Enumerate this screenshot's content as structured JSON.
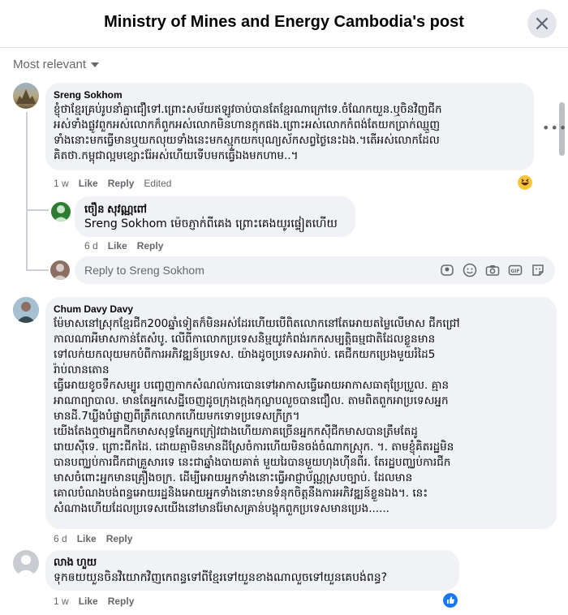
{
  "header": {
    "title": "Ministry of Mines and Energy Cambodia's post",
    "close_icon": "close-icon"
  },
  "sort": {
    "label": "Most relevant"
  },
  "comments": [
    {
      "author": "Sreng Sokhom",
      "text": "ខ្ញុំថាខ្មែរគ្រប់រូបនាំគ្នាជឿទៅ.ព្រោះសម័យឥឡូវចាប់បានតែខ្មែរណាក្រៅទេ.ចំណែកយួន.ឬចិនវិញជីក\nអស់ទាំងផ្លូវពួកអស់លោកក៏ពួកអស់លោកមិនហានក្តុកផង.ព្រោះអស់លោកកំពង់តែយកប្រាក់ឈ្មួញ\nទាំងនោះមកធ្វើមានឬយកលុយទាំងនេះមកស្មុកយកបុណ្យស័កសព្វថ្ងៃនេះឯង.។តើអស់លោកដែល\nគិតថា.កម្ពុជាល្អមខ្សោះរ៉ែអស់ហើយទើបមកធ្វើឯងមកហាម..។",
      "time": "1 w",
      "like": "Like",
      "reply": "Reply",
      "edited": "Edited",
      "reaction": "haha"
    },
    {
      "author": "ចឿន សុវណ្ណពៅ",
      "text": "Sreng Sokhom ម៉េចភ្ញាក់ពីគេង ព្រោះគេងយូរផ្ទៀតហើយ",
      "time": "6 d",
      "like": "Like",
      "reply": "Reply"
    },
    {
      "author": "Chum Davy Davy",
      "text": "ម៉ែមាសនៅស្រុកខ្មែរជីក200ឆ្នាំទៀតក៏មិនអស់ដែរហើយបើពិតលោកនៅតែអោយតម្លៃលើមាស ជីកជ្រៅ\nកាលណាអីមាសកាន់តែសំបូ. លើពីកាលោកប្រទេសនិម្មយូវកំពង់រកកសម្បត្តិធម្មជាតិដែលខ្លួនមាន\nទៅលក់យកលុយមកបំពីការអភិវឌ្ឍន៍ប្រទេស. យ៉ាងដូចប្រទេសអារ៉ាប់. គេជីកយកប្រេងមួយរំដៃ5\nរ៉ាប់លានតោន\nធ្វើអោយខូចទឹកសម្បូរ បញ្ចេញកាកសំណល់ការបោនទៅអាកាសធ្វើអោយអាកាសធាតុប្រែប្រួល. គ្មាន\nអាណាព្យាបាល. មានតែអ្នកសេដ្ឋីចេញដូចក្រុងក្ដេងកុល្លាបលួចបានជឿល. តាមពិតពួកអាប្រទេសអ្នក\nមានដី.7ឃ្លីងបំផ្លាញពីត្រឹកលោកហើយមកទោទប្រទេសក្រីក្រ។\nយើងតែងឮថាអ្នកជីកមាសសុទ្ធតែអ្នកក្រៀវជាងហើយភាគច្រើនអ្នកកស៊ីជីកមាសបានត្រឹមតែដូ\nរោយស៊ីទេ. ព្រោះជីកដៃ. ដោយគ្មាមិនមានដីស្រែចំការហើយមិនចង់ចំណាកស្រុក. ។. តាមខ្ញុំគិតរដ្ឋមិន\nបានបញ្ឈប់ការជីកជាគ្រួសារទេ នេះជាឆ្នាំងបាយគាត់ មួយរៃបានមួយហុងហ៊ីនពីរ. តែរដ្ឋបញ្ឈប់ការជីក\nមាសចំពោះអ្នកមានគ្រឿងចក្រ. ដើម្បីអោយអ្នកទាំងនោះធ្វើអាជ្ញាប័ណ្ណស្របច្បាប់. ដែលមាន\nគោលបំណងបង់ពន្ធអោយរដ្ឋនិងអោយអ្នកទាំងនោះមានទំនុកចិត្តនឹងការអភិវឌ្ឍន៍ខ្លួនឯង។. នេះ\nសំណាងហើយដែលប្រទេសយើងនៅមានរ៉ែមាសគ្រាន់បង្គុកពួកប្រទេសមានប្រេង......",
      "time": "6 d",
      "like": "Like",
      "reply": "Reply"
    },
    {
      "author": "លាង ហួយ",
      "text": "ទុកឲយយួនចិនវិយោកវិញកេពន្ធទៅពីខ្មែរទៅយួនខាងណាលួចទៅយួនគេបង់ពន្ធ?",
      "time": "1 w",
      "like": "Like",
      "reply": "Reply",
      "reaction": "like"
    }
  ],
  "reply_box": {
    "placeholder": "Reply to Sreng Sokhom"
  },
  "colors": {
    "bubble": "#f0f2f5",
    "meta": "#65676b",
    "accent": "#1877f2"
  }
}
